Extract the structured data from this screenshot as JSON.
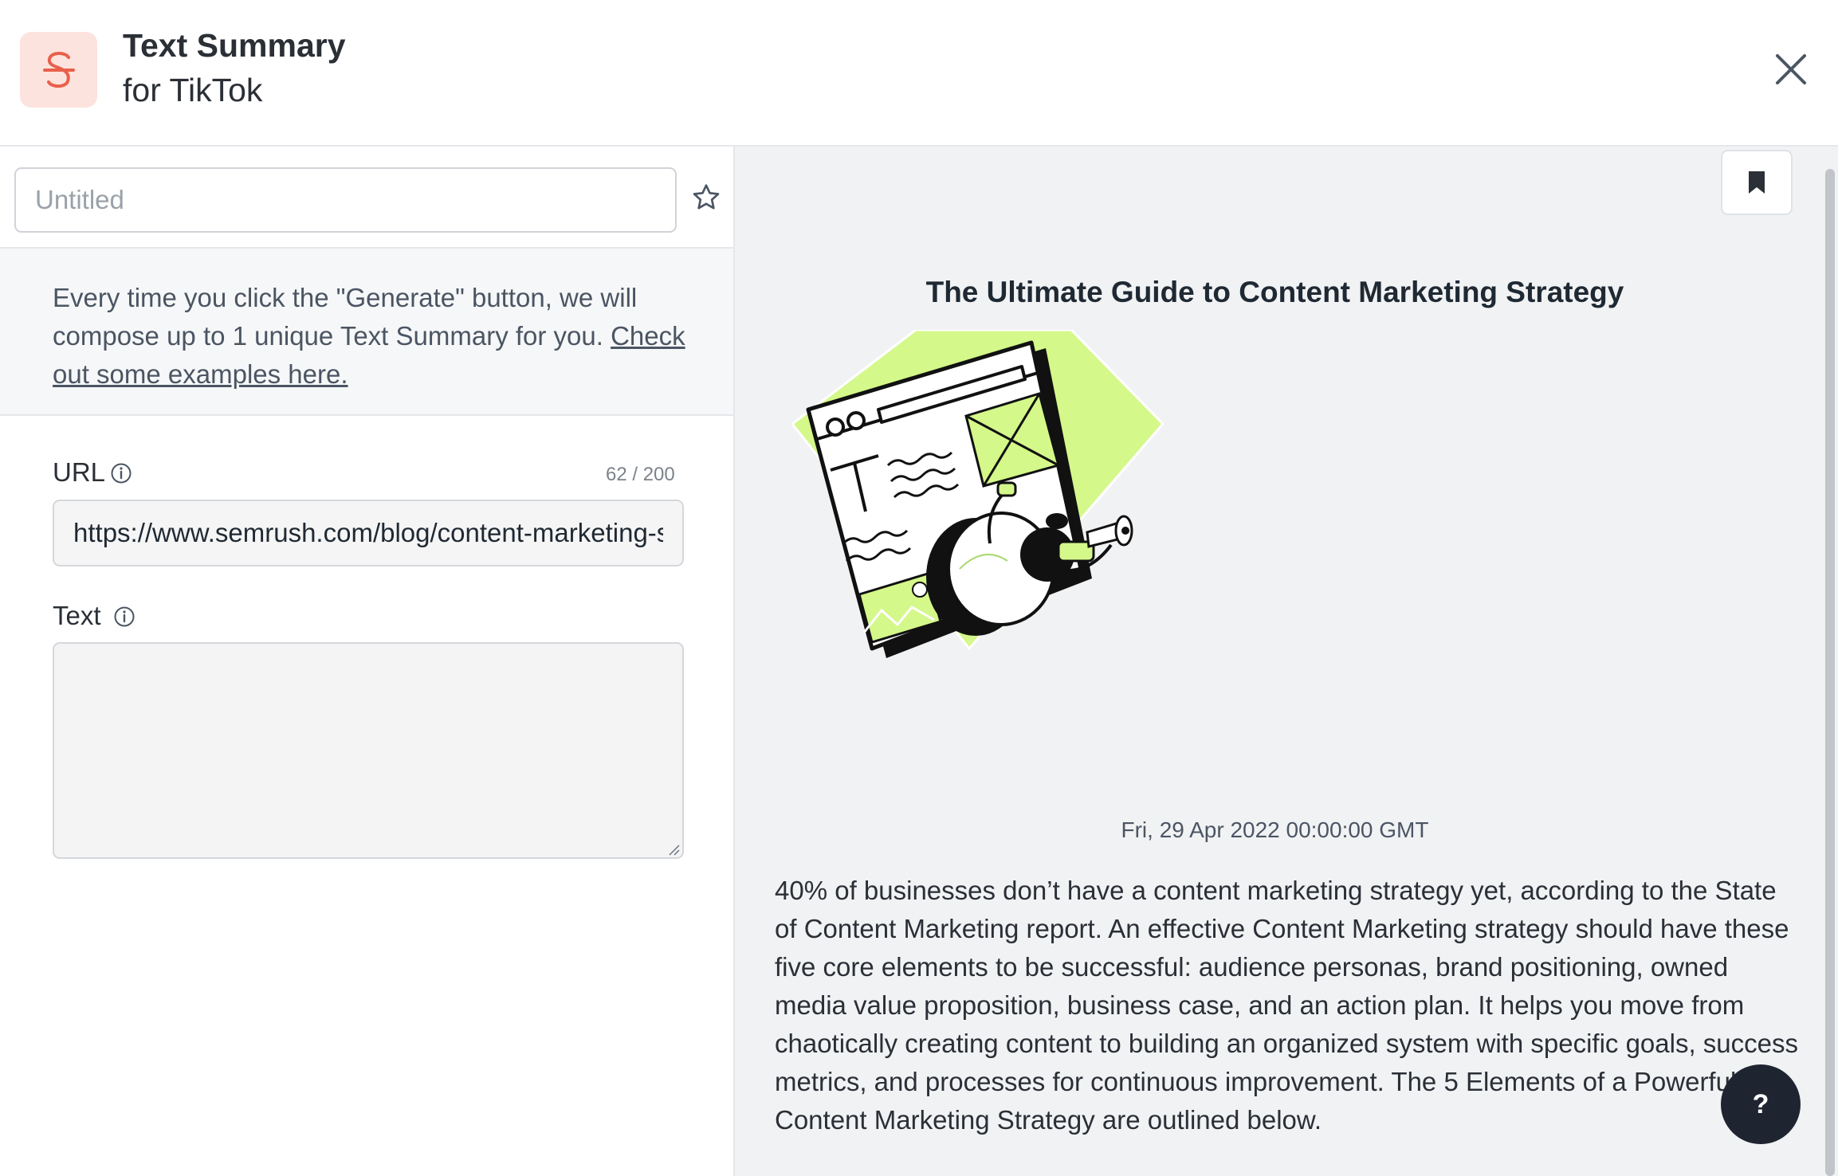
{
  "header": {
    "title": "Text Summary",
    "subtitle": "for TikTok",
    "logo_icon": "s-logo-icon",
    "close_icon": "close-icon"
  },
  "left": {
    "title_placeholder": "Untitled",
    "info_text": "Every time you click the \"Generate\" button, we will compose up to 1 unique Text Summary for you.",
    "info_link": "Check out some examples here.",
    "url_label": "URL",
    "url_counter": "62 / 200",
    "url_value": "https://www.semrush.com/blog/content-marketing-strategy-guide/",
    "text_label": "Text",
    "text_value": ""
  },
  "right": {
    "article_title": "The Ultimate Guide to Content Marketing Strategy",
    "article_date": "Fri, 29 Apr 2022 00:00:00 GMT",
    "article_body": "40% of businesses don’t have a content marketing strategy yet, according to the State of Content Marketing report. An effective Content Marketing strategy should have these five core elements to be successful: audience personas, brand positioning, owned media value proposition, business case, and an action plan. It helps you move from chaotically creating content to building an organized system with specific goals, success metrics, and processes for continuous improvement. The 5 Elements of a Powerful Content Marketing Strategy are outlined below.",
    "help_label": "?"
  },
  "colors": {
    "accent_logo_bg": "#fde3dd",
    "accent_logo_fg": "#e8604c",
    "illustration_green": "#d4f88a",
    "help_button_bg": "#1e2530"
  }
}
